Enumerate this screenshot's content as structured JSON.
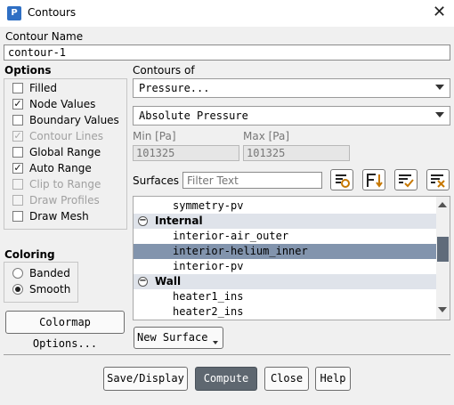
{
  "window": {
    "title": "Contours",
    "app_icon_letter": "P"
  },
  "contour_name": {
    "label": "Contour Name",
    "value": "contour-1"
  },
  "options": {
    "label": "Options",
    "items": [
      {
        "label": "Filled",
        "checked": false,
        "enabled": true
      },
      {
        "label": "Node Values",
        "checked": true,
        "enabled": true
      },
      {
        "label": "Boundary Values",
        "checked": false,
        "enabled": true
      },
      {
        "label": "Contour Lines",
        "checked": true,
        "enabled": false
      },
      {
        "label": "Global Range",
        "checked": false,
        "enabled": true
      },
      {
        "label": "Auto Range",
        "checked": true,
        "enabled": true
      },
      {
        "label": "Clip to Range",
        "checked": false,
        "enabled": false
      },
      {
        "label": "Draw Profiles",
        "checked": false,
        "enabled": false
      },
      {
        "label": "Draw Mesh",
        "checked": false,
        "enabled": true
      }
    ]
  },
  "coloring": {
    "label": "Coloring",
    "items": [
      {
        "label": "Banded",
        "selected": false
      },
      {
        "label": "Smooth",
        "selected": true
      }
    ],
    "colormap_button": "Colormap Options..."
  },
  "contours_of": {
    "label": "Contours of",
    "category": "Pressure...",
    "quantity": "Absolute Pressure",
    "min_label": "Min [Pa]",
    "min_value": "101325",
    "max_label": "Max [Pa]",
    "max_value": "101325"
  },
  "surfaces": {
    "label": "Surfaces",
    "filter_placeholder": "Filter Text",
    "rows": [
      {
        "text": "symmetry-pv",
        "type": "item",
        "selected": false
      },
      {
        "text": "Internal",
        "type": "group",
        "selected": false
      },
      {
        "text": "interior-air_outer",
        "type": "item",
        "selected": false
      },
      {
        "text": "interior-helium_inner",
        "type": "item",
        "selected": true
      },
      {
        "text": "interior-pv",
        "type": "item",
        "selected": false
      },
      {
        "text": "Wall",
        "type": "group",
        "selected": false
      },
      {
        "text": "heater1_ins",
        "type": "item",
        "selected": false
      },
      {
        "text": "heater2_ins",
        "type": "item",
        "selected": false
      }
    ],
    "new_surface_button": "New Surface"
  },
  "buttons": {
    "save_display": "Save/Display",
    "compute": "Compute",
    "close": "Close",
    "help": "Help"
  },
  "glyphs": {
    "check": "✓",
    "close": "✕",
    "minus": "−"
  }
}
